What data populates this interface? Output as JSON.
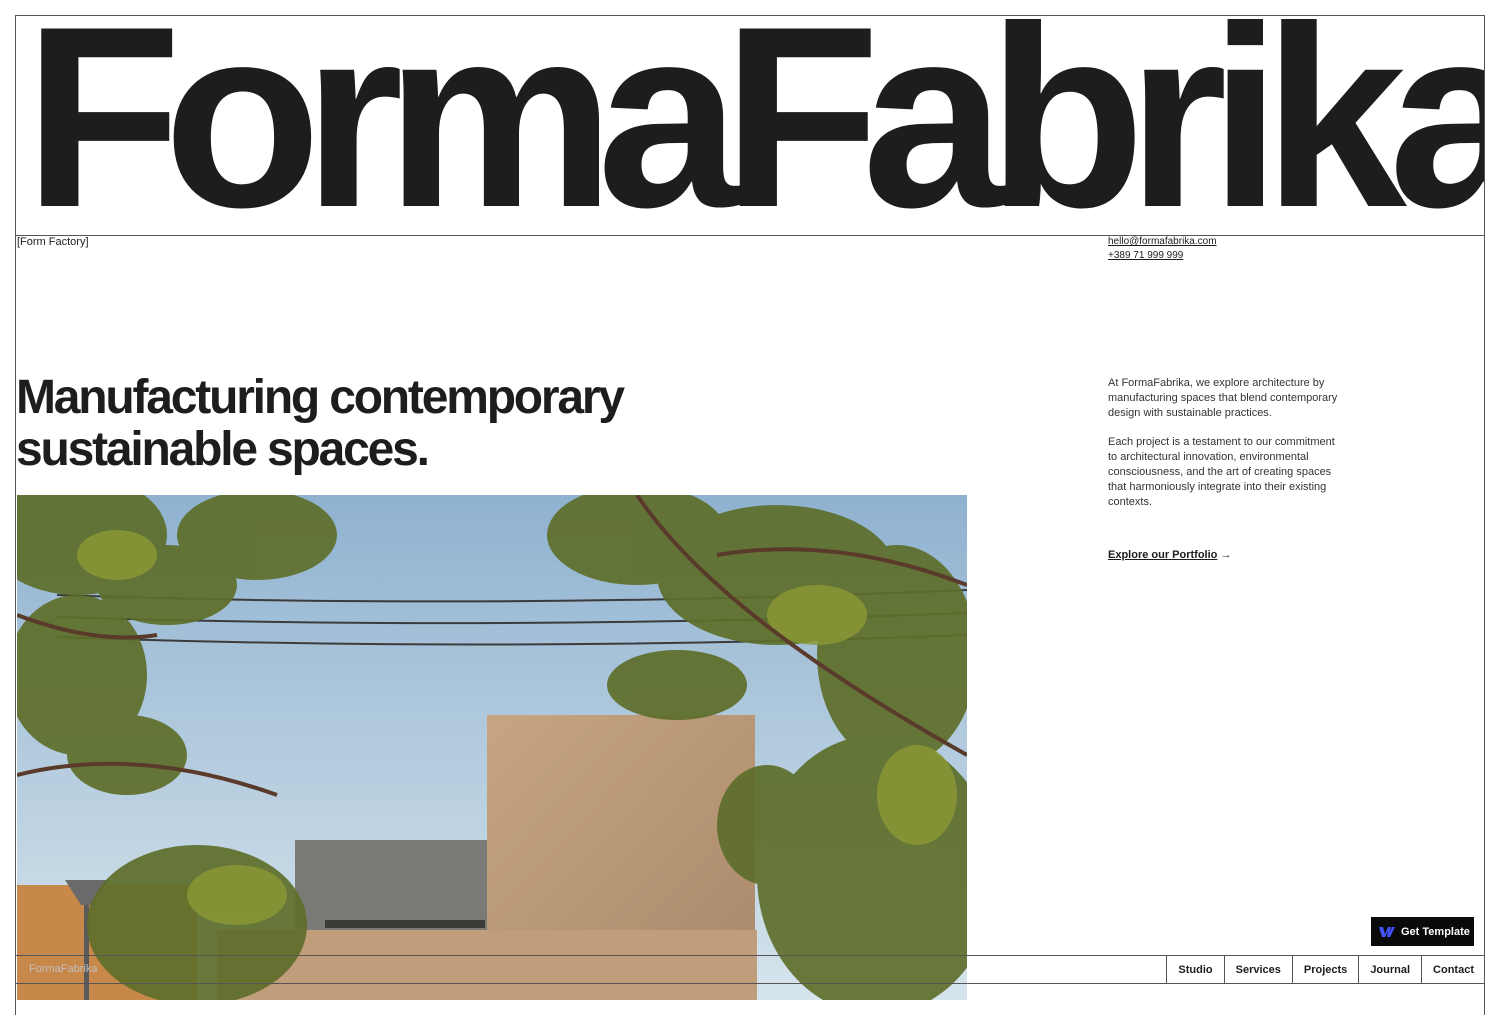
{
  "brand": {
    "name": "FormaFabrika"
  },
  "tagline": "[Form Factory]",
  "contact": {
    "email": "hello@formafabrika.com",
    "phone": "+389 71 999 999"
  },
  "hero": {
    "headline_line1": "Manufacturing contemporary",
    "headline_line2": "sustainable spaces."
  },
  "intro": {
    "paragraph1": "At FormaFabrika, we explore architecture by manufacturing spaces that blend contemporary design with sustainable practices.",
    "paragraph2": "Each project is a testament to our commitment to architectural innovation, environmental consciousness, and the art of creating spaces that harmoniously integrate into their existing contexts.",
    "link_label": "Explore our Portfolio",
    "link_arrow": "→"
  },
  "cta": {
    "get_template": "Get Template",
    "icon": "webflow-icon"
  },
  "footer": {
    "logo_text": "FormaFabrika",
    "nav": [
      "Studio",
      "Services",
      "Projects",
      "Journal",
      "Contact"
    ]
  },
  "colors": {
    "ink": "#1d1d1f",
    "sky": "#a9c3d8",
    "concrete": "#c9a47e",
    "foliage": "#5c6b2a"
  }
}
